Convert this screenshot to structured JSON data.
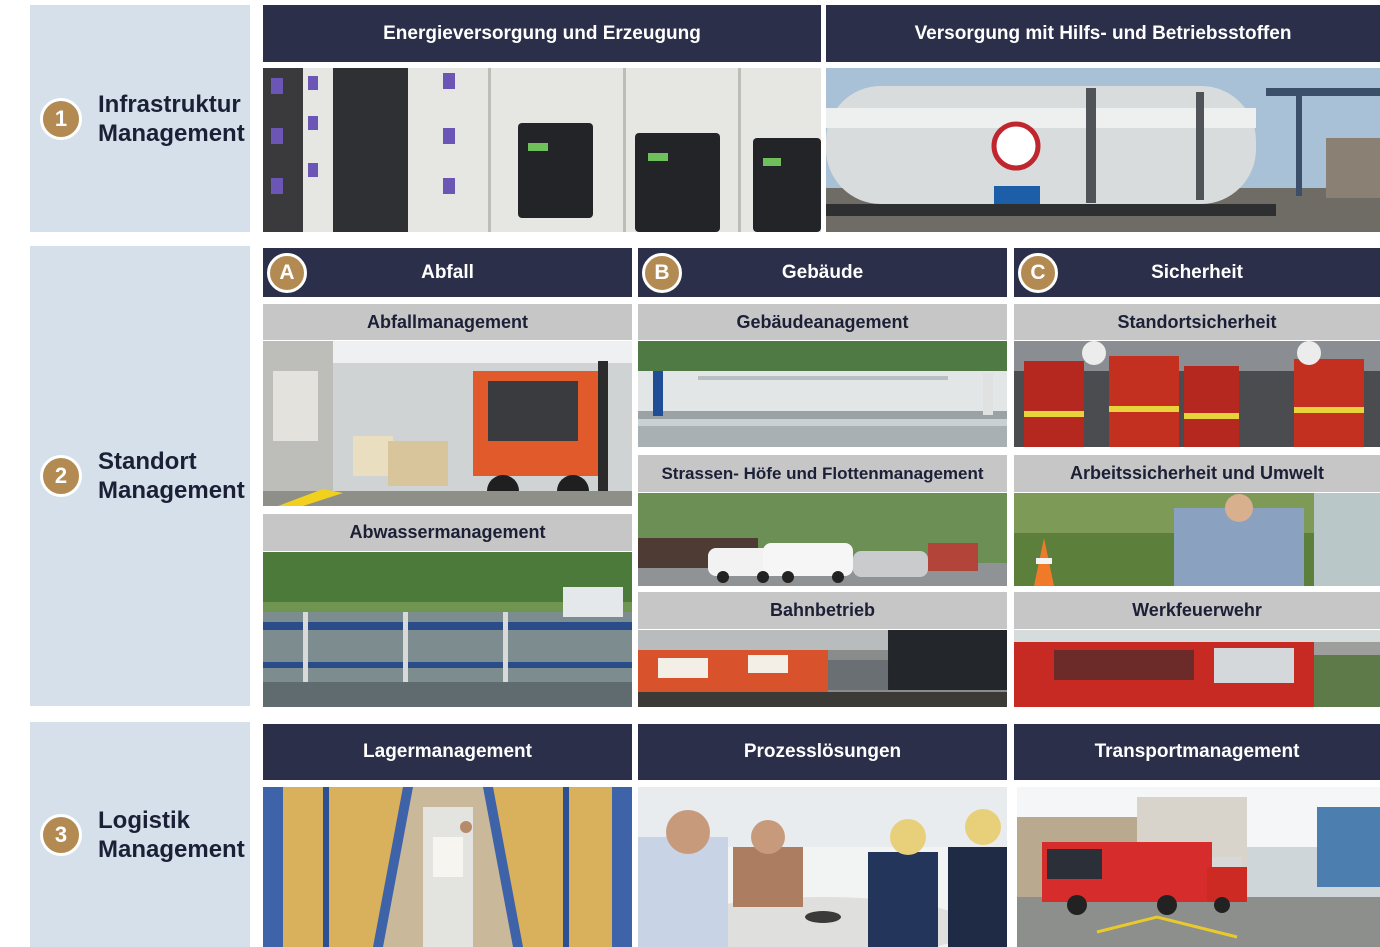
{
  "sections": [
    {
      "number": "1",
      "title_line1": "Infrastruktur",
      "title_line2": "Management"
    },
    {
      "number": "2",
      "title_line1": "Standort",
      "title_line2": "Management"
    },
    {
      "number": "3",
      "title_line1": "Logistik",
      "title_line2": "Management"
    }
  ],
  "infrastruktur": {
    "col1": "Energieversorgung und Erzeugung",
    "col2": "Versorgung mit Hilfs- und Betriebsstoffen"
  },
  "standort": {
    "abfall": {
      "letter": "A",
      "title": "Abfall",
      "items": [
        "Abfallmanagement",
        "Abwassermanagement"
      ]
    },
    "gebaeude": {
      "letter": "B",
      "title": "Gebäude",
      "items": [
        "Gebäudeanagement",
        "Strassen- Höfe und Flottenmanagement",
        "Bahnbetrieb"
      ]
    },
    "sicherheit": {
      "letter": "C",
      "title": "Sicherheit",
      "items": [
        "Standortsicherheit",
        "Arbeitssicherheit und Umwelt",
        "Werkfeuerwehr"
      ]
    }
  },
  "logistik": {
    "col1": "Lagermanagement",
    "col2": "Prozesslösungen",
    "col3": "Transportmanagement"
  },
  "colors": {
    "header_navy": "#2b2f49",
    "badge_gold": "#b38b52",
    "side_panel": "#d5e0ea",
    "subheader_grey": "#c6c6c6"
  }
}
